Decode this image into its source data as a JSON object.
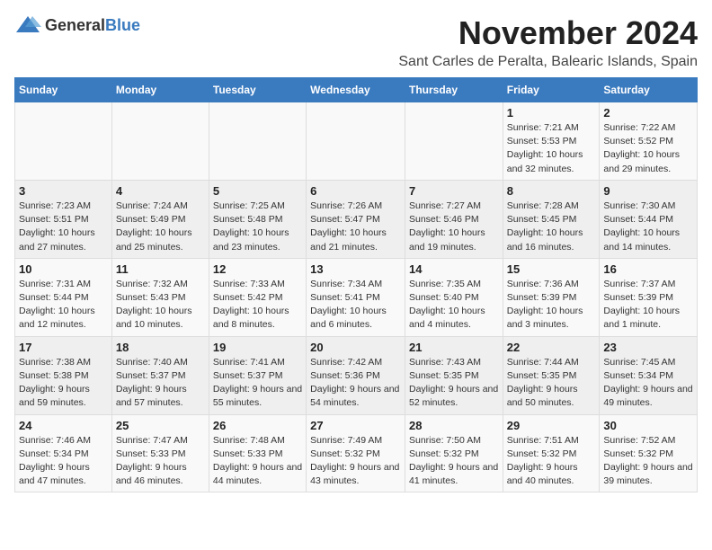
{
  "logo": {
    "text_general": "General",
    "text_blue": "Blue"
  },
  "header": {
    "month": "November 2024",
    "location": "Sant Carles de Peralta, Balearic Islands, Spain"
  },
  "weekdays": [
    "Sunday",
    "Monday",
    "Tuesday",
    "Wednesday",
    "Thursday",
    "Friday",
    "Saturday"
  ],
  "weeks": [
    [
      {
        "day": "",
        "info": ""
      },
      {
        "day": "",
        "info": ""
      },
      {
        "day": "",
        "info": ""
      },
      {
        "day": "",
        "info": ""
      },
      {
        "day": "",
        "info": ""
      },
      {
        "day": "1",
        "info": "Sunrise: 7:21 AM\nSunset: 5:53 PM\nDaylight: 10 hours and 32 minutes."
      },
      {
        "day": "2",
        "info": "Sunrise: 7:22 AM\nSunset: 5:52 PM\nDaylight: 10 hours and 29 minutes."
      }
    ],
    [
      {
        "day": "3",
        "info": "Sunrise: 7:23 AM\nSunset: 5:51 PM\nDaylight: 10 hours and 27 minutes."
      },
      {
        "day": "4",
        "info": "Sunrise: 7:24 AM\nSunset: 5:49 PM\nDaylight: 10 hours and 25 minutes."
      },
      {
        "day": "5",
        "info": "Sunrise: 7:25 AM\nSunset: 5:48 PM\nDaylight: 10 hours and 23 minutes."
      },
      {
        "day": "6",
        "info": "Sunrise: 7:26 AM\nSunset: 5:47 PM\nDaylight: 10 hours and 21 minutes."
      },
      {
        "day": "7",
        "info": "Sunrise: 7:27 AM\nSunset: 5:46 PM\nDaylight: 10 hours and 19 minutes."
      },
      {
        "day": "8",
        "info": "Sunrise: 7:28 AM\nSunset: 5:45 PM\nDaylight: 10 hours and 16 minutes."
      },
      {
        "day": "9",
        "info": "Sunrise: 7:30 AM\nSunset: 5:44 PM\nDaylight: 10 hours and 14 minutes."
      }
    ],
    [
      {
        "day": "10",
        "info": "Sunrise: 7:31 AM\nSunset: 5:44 PM\nDaylight: 10 hours and 12 minutes."
      },
      {
        "day": "11",
        "info": "Sunrise: 7:32 AM\nSunset: 5:43 PM\nDaylight: 10 hours and 10 minutes."
      },
      {
        "day": "12",
        "info": "Sunrise: 7:33 AM\nSunset: 5:42 PM\nDaylight: 10 hours and 8 minutes."
      },
      {
        "day": "13",
        "info": "Sunrise: 7:34 AM\nSunset: 5:41 PM\nDaylight: 10 hours and 6 minutes."
      },
      {
        "day": "14",
        "info": "Sunrise: 7:35 AM\nSunset: 5:40 PM\nDaylight: 10 hours and 4 minutes."
      },
      {
        "day": "15",
        "info": "Sunrise: 7:36 AM\nSunset: 5:39 PM\nDaylight: 10 hours and 3 minutes."
      },
      {
        "day": "16",
        "info": "Sunrise: 7:37 AM\nSunset: 5:39 PM\nDaylight: 10 hours and 1 minute."
      }
    ],
    [
      {
        "day": "17",
        "info": "Sunrise: 7:38 AM\nSunset: 5:38 PM\nDaylight: 9 hours and 59 minutes."
      },
      {
        "day": "18",
        "info": "Sunrise: 7:40 AM\nSunset: 5:37 PM\nDaylight: 9 hours and 57 minutes."
      },
      {
        "day": "19",
        "info": "Sunrise: 7:41 AM\nSunset: 5:37 PM\nDaylight: 9 hours and 55 minutes."
      },
      {
        "day": "20",
        "info": "Sunrise: 7:42 AM\nSunset: 5:36 PM\nDaylight: 9 hours and 54 minutes."
      },
      {
        "day": "21",
        "info": "Sunrise: 7:43 AM\nSunset: 5:35 PM\nDaylight: 9 hours and 52 minutes."
      },
      {
        "day": "22",
        "info": "Sunrise: 7:44 AM\nSunset: 5:35 PM\nDaylight: 9 hours and 50 minutes."
      },
      {
        "day": "23",
        "info": "Sunrise: 7:45 AM\nSunset: 5:34 PM\nDaylight: 9 hours and 49 minutes."
      }
    ],
    [
      {
        "day": "24",
        "info": "Sunrise: 7:46 AM\nSunset: 5:34 PM\nDaylight: 9 hours and 47 minutes."
      },
      {
        "day": "25",
        "info": "Sunrise: 7:47 AM\nSunset: 5:33 PM\nDaylight: 9 hours and 46 minutes."
      },
      {
        "day": "26",
        "info": "Sunrise: 7:48 AM\nSunset: 5:33 PM\nDaylight: 9 hours and 44 minutes."
      },
      {
        "day": "27",
        "info": "Sunrise: 7:49 AM\nSunset: 5:32 PM\nDaylight: 9 hours and 43 minutes."
      },
      {
        "day": "28",
        "info": "Sunrise: 7:50 AM\nSunset: 5:32 PM\nDaylight: 9 hours and 41 minutes."
      },
      {
        "day": "29",
        "info": "Sunrise: 7:51 AM\nSunset: 5:32 PM\nDaylight: 9 hours and 40 minutes."
      },
      {
        "day": "30",
        "info": "Sunrise: 7:52 AM\nSunset: 5:32 PM\nDaylight: 9 hours and 39 minutes."
      }
    ]
  ]
}
